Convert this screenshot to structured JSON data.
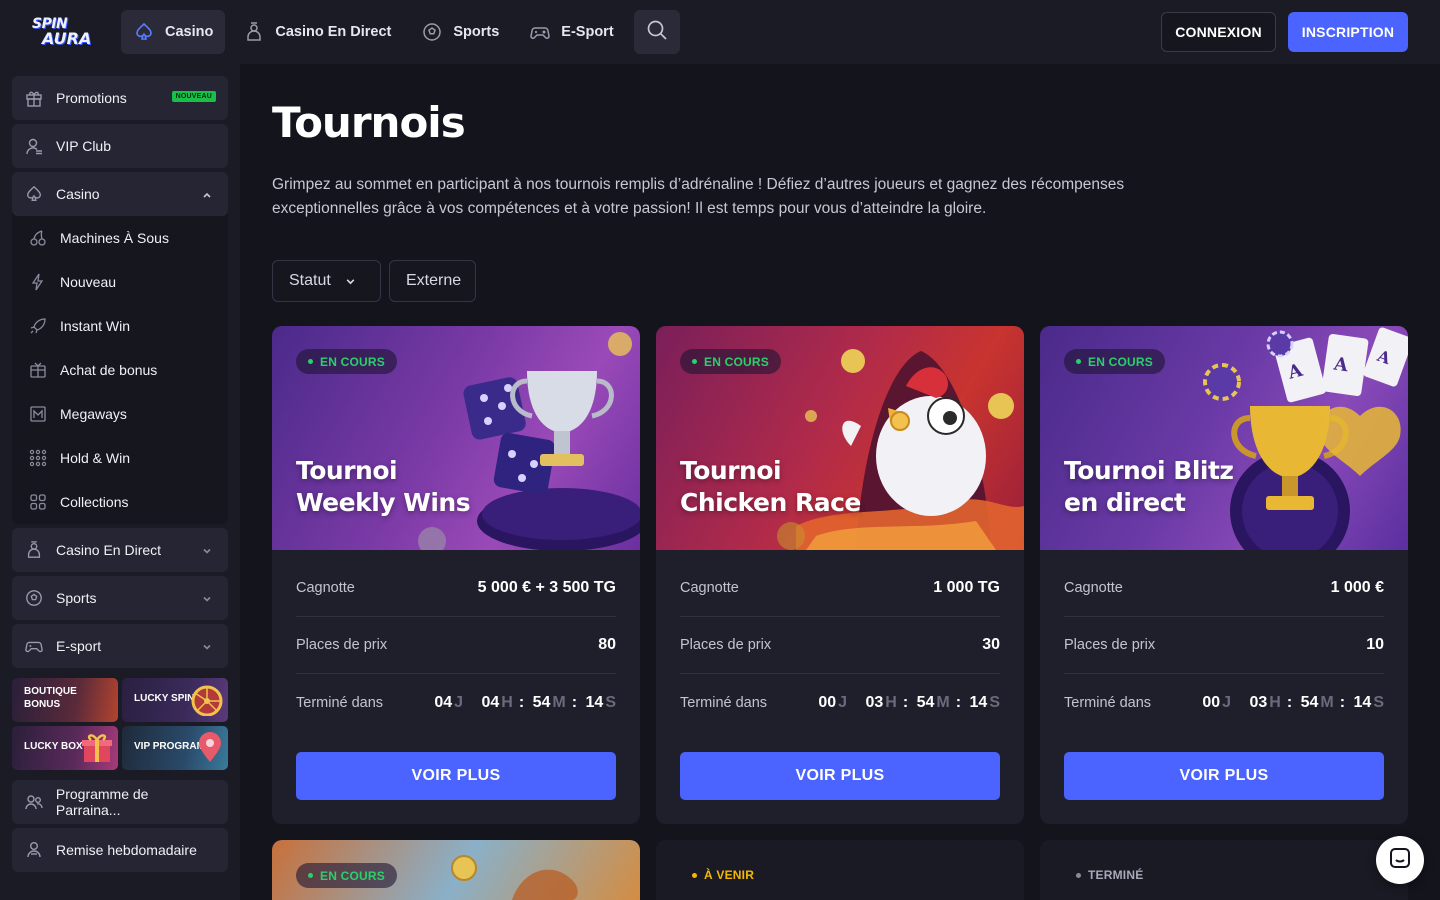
{
  "brand": {
    "logo_line1": "SPIN",
    "logo_line2": "AURA"
  },
  "topnav": {
    "items": [
      {
        "label": "Casino",
        "icon": "spade-icon",
        "active": true
      },
      {
        "label": "Casino En Direct",
        "icon": "dealer-icon",
        "active": false
      },
      {
        "label": "Sports",
        "icon": "soccer-ball-icon",
        "active": false
      },
      {
        "label": "E-Sport",
        "icon": "gamepad-icon",
        "active": false
      }
    ],
    "login_label": "CONNEXION",
    "signup_label": "INSCRIPTION"
  },
  "sidebar": {
    "promotions": {
      "label": "Promotions",
      "badge": "NOUVEAU"
    },
    "vip": {
      "label": "VIP Club"
    },
    "casino": {
      "label": "Casino",
      "children": [
        {
          "label": "Machines À Sous",
          "icon": "cherries-icon"
        },
        {
          "label": "Nouveau",
          "icon": "lightning-icon"
        },
        {
          "label": "Instant Win",
          "icon": "rocket-icon"
        },
        {
          "label": "Achat de bonus",
          "icon": "gift-box-icon"
        },
        {
          "label": "Megaways",
          "icon": "megaways-icon"
        },
        {
          "label": "Hold & Win",
          "icon": "dots-grid-icon"
        },
        {
          "label": "Collections",
          "icon": "collections-icon"
        }
      ]
    },
    "casino_live": {
      "label": "Casino En Direct"
    },
    "sports": {
      "label": "Sports"
    },
    "esport": {
      "label": "E-sport"
    },
    "promo_tiles": [
      {
        "line1": "BOUTIQUE",
        "line2": "BONUS"
      },
      {
        "line1": "LUCKY SPIN",
        "line2": ""
      },
      {
        "line1": "LUCKY BOX",
        "line2": ""
      },
      {
        "line1": "VIP PROGRAM",
        "line2": ""
      }
    ],
    "referral": {
      "label": "Programme de Parraina..."
    },
    "weekly": {
      "label": "Remise hebdomadaire"
    }
  },
  "page": {
    "title": "Tournois",
    "description": "Grimpez au sommet en participant à nos tournois remplis d’adrénaline ! Défiez d’autres joueurs et gagnez des récompenses exceptionnelles grâce à vos compétences et à votre passion! Il est temps pour vous d’atteindre la gloire.",
    "filters": {
      "status_label": "Statut",
      "external_label": "Externe"
    }
  },
  "labels": {
    "prize_pool": "Cagnotte",
    "prize_places": "Places de prix",
    "ends_in": "Terminé dans",
    "view_more": "VOIR PLUS",
    "unit_days": "J",
    "unit_hours": "H",
    "unit_minutes": "M",
    "unit_seconds": "S"
  },
  "tournaments": [
    {
      "status": "EN COURS",
      "title_line1": "Tournoi",
      "title_line2": "Weekly Wins",
      "prize_pool": "5 000 € + 3 500 TG",
      "places": "80",
      "days": "04",
      "hours": "04",
      "minutes": "54",
      "seconds": "14"
    },
    {
      "status": "EN COURS",
      "title_line1": "Tournoi",
      "title_line2": "Chicken Race",
      "prize_pool": "1 000 TG",
      "places": "30",
      "days": "00",
      "hours": "03",
      "minutes": "54",
      "seconds": "14"
    },
    {
      "status": "EN COURS",
      "title_line1": "Tournoi Blitz",
      "title_line2": "en direct",
      "prize_pool": "1 000 €",
      "places": "10",
      "days": "00",
      "hours": "03",
      "minutes": "54",
      "seconds": "14"
    }
  ],
  "next_row": {
    "card4_status": "EN COURS",
    "upcoming_label": "À VENIR",
    "finished_label": "TERMINÉ"
  },
  "colors": {
    "accent": "#4b63ff",
    "live_green": "#29d16a",
    "upcoming_yellow": "#f5b800",
    "finished_gray": "#8a8a9a",
    "background": "#14141d",
    "panel": "#1b1b26"
  }
}
